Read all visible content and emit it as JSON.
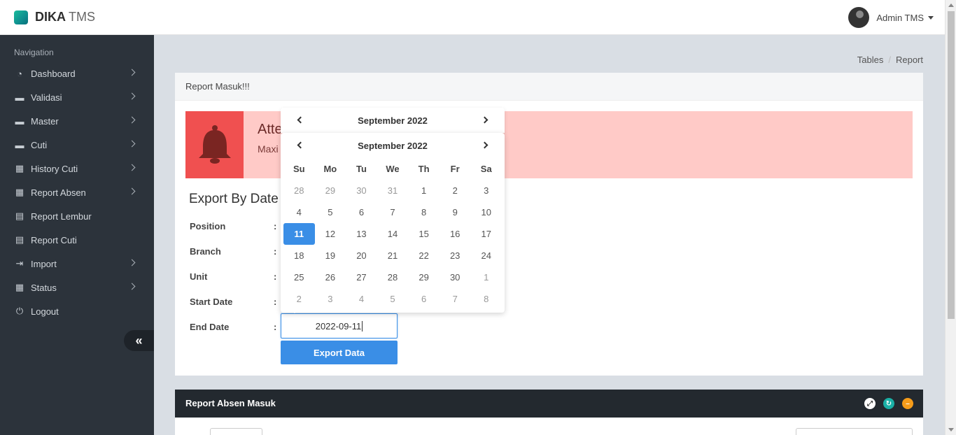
{
  "header": {
    "brand_bold": "DIKA",
    "brand_light": "TMS",
    "user_name": "Admin TMS"
  },
  "sidebar": {
    "heading": "Navigation",
    "items": [
      {
        "label": "Dashboard",
        "icon": "dashboard-icon",
        "has_submenu": true
      },
      {
        "label": "Validasi",
        "icon": "folder-icon",
        "has_submenu": true
      },
      {
        "label": "Master",
        "icon": "folder-icon",
        "has_submenu": true
      },
      {
        "label": "Cuti",
        "icon": "folder-icon",
        "has_submenu": true
      },
      {
        "label": "History Cuti",
        "icon": "calendar-check-icon",
        "has_submenu": true
      },
      {
        "label": "Report Absen",
        "icon": "calendar-check-icon",
        "has_submenu": true
      },
      {
        "label": "Report Lembur",
        "icon": "file-excel-icon",
        "has_submenu": false
      },
      {
        "label": "Report Cuti",
        "icon": "file-excel-icon",
        "has_submenu": false
      },
      {
        "label": "Import",
        "icon": "file-import-icon",
        "has_submenu": true
      },
      {
        "label": "Status",
        "icon": "calendar-check-icon",
        "has_submenu": true
      },
      {
        "label": "Logout",
        "icon": "power-icon",
        "has_submenu": false
      }
    ],
    "collapse_glyph": "«"
  },
  "breadcrumb": {
    "items": [
      "Tables",
      "Report"
    ],
    "separator": "/"
  },
  "panel": {
    "title": "Report Masuk!!!",
    "alert": {
      "title": "Atte",
      "text": "Maxi",
      "icon": "bell-icon"
    },
    "section_title": "Export By Date",
    "fields": [
      {
        "label": "Position"
      },
      {
        "label": "Branch"
      },
      {
        "label": "Unit"
      },
      {
        "label": "Start Date"
      },
      {
        "label": "End Date"
      }
    ],
    "colon": ":",
    "end_date_value": "2022-09-11",
    "export_button": "Export Data"
  },
  "panel2": {
    "title": "Report Absen Masuk",
    "tools": [
      "expand-icon",
      "reload-icon",
      "collapse-icon"
    ]
  },
  "datepicker": {
    "back_month_label": "September 2022",
    "month_label": "September 2022",
    "weekdays": [
      "Su",
      "Mo",
      "Tu",
      "We",
      "Th",
      "Fr",
      "Sa"
    ],
    "weeks": [
      [
        {
          "d": "28",
          "m": true
        },
        {
          "d": "29",
          "m": true
        },
        {
          "d": "30",
          "m": true
        },
        {
          "d": "31",
          "m": true
        },
        {
          "d": "1"
        },
        {
          "d": "2"
        },
        {
          "d": "3"
        }
      ],
      [
        {
          "d": "4"
        },
        {
          "d": "5"
        },
        {
          "d": "6"
        },
        {
          "d": "7"
        },
        {
          "d": "8"
        },
        {
          "d": "9"
        },
        {
          "d": "10"
        }
      ],
      [
        {
          "d": "11",
          "active": true
        },
        {
          "d": "12"
        },
        {
          "d": "13"
        },
        {
          "d": "14"
        },
        {
          "d": "15"
        },
        {
          "d": "16"
        },
        {
          "d": "17"
        }
      ],
      [
        {
          "d": "18"
        },
        {
          "d": "19"
        },
        {
          "d": "20"
        },
        {
          "d": "21"
        },
        {
          "d": "22"
        },
        {
          "d": "23"
        },
        {
          "d": "24"
        }
      ],
      [
        {
          "d": "25"
        },
        {
          "d": "26"
        },
        {
          "d": "27"
        },
        {
          "d": "28"
        },
        {
          "d": "29"
        },
        {
          "d": "30"
        },
        {
          "d": "1",
          "m": true
        }
      ],
      [
        {
          "d": "2",
          "m": true
        },
        {
          "d": "3",
          "m": true
        },
        {
          "d": "4",
          "m": true
        },
        {
          "d": "5",
          "m": true
        },
        {
          "d": "6",
          "m": true
        },
        {
          "d": "7",
          "m": true
        },
        {
          "d": "8",
          "m": true
        }
      ]
    ]
  },
  "colors": {
    "accent": "#3a8ee6",
    "sidebar_bg": "#2c333b",
    "alert_bg": "#ffcac7",
    "alert_icon_bg": "#f05050"
  }
}
